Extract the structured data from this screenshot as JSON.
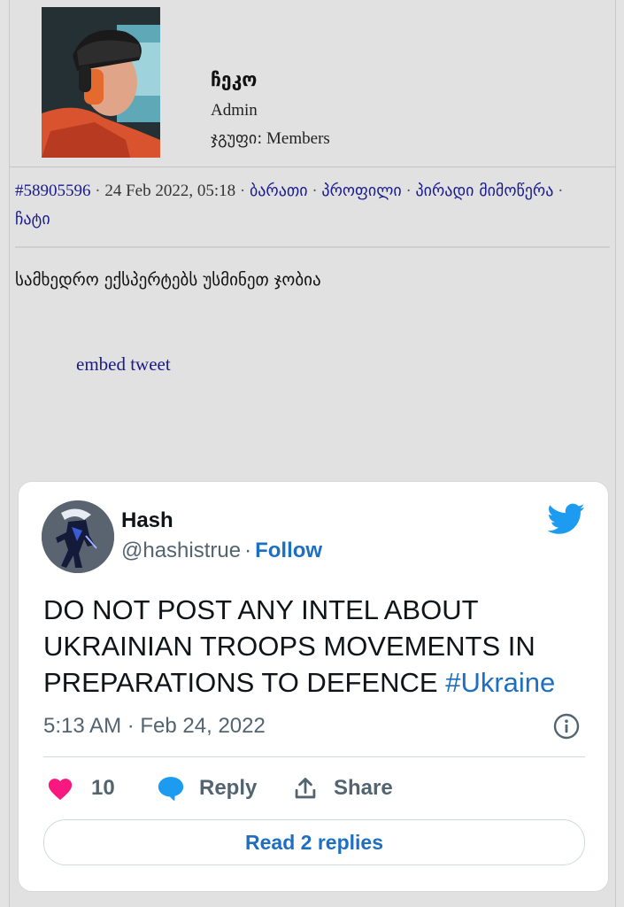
{
  "user": {
    "username": "ჩეკო",
    "role": "Admin",
    "group_label": "ჯგუფი:",
    "group_value": "Members"
  },
  "post_meta": {
    "post_id": "#58905596",
    "date": "24 Feb 2022, 05:18",
    "links": [
      "ბარათი",
      "პროფილი",
      "პირადი მიმოწერა",
      "ჩატი"
    ]
  },
  "post": {
    "text": "სამხედრო ექსპერტებს უსმინეთ ჯობია",
    "embed_link": "embed tweet"
  },
  "tweet": {
    "name": "Hash",
    "handle": "@hashistrue",
    "follow_label": "Follow",
    "body": "DO NOT POST ANY INTEL ABOUT UKRAINIAN TROOPS MOVEMENTS IN PREPARATIONS TO DEFENCE",
    "hashtag": "#Ukraine",
    "timestamp": "5:13 AM · Feb 24, 2022",
    "like_count": "10",
    "reply_label": "Reply",
    "share_label": "Share",
    "read_replies_label": "Read 2 replies",
    "colors": {
      "link": "#1d6fc2",
      "like": "#f91880",
      "bird": "#1d9bf0"
    }
  }
}
